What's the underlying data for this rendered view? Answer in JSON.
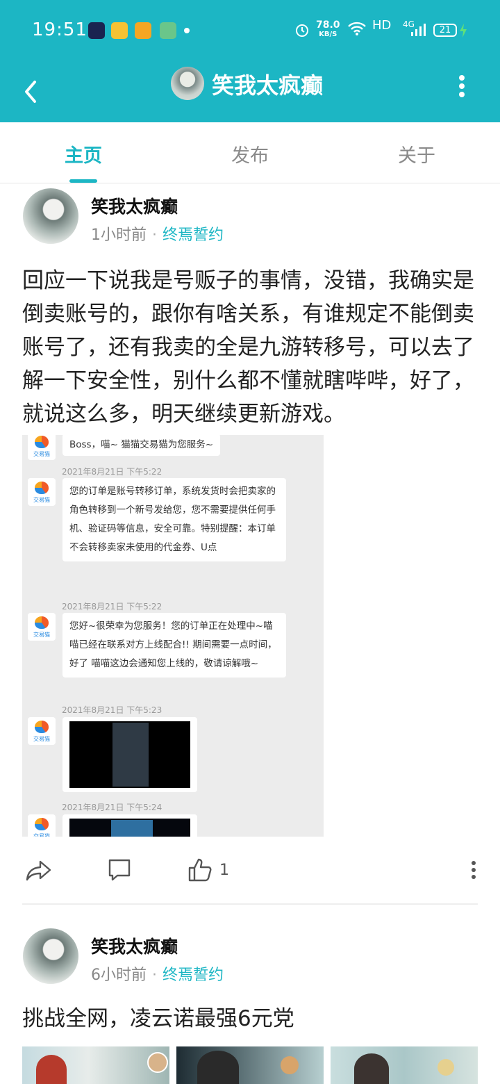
{
  "status": {
    "time": "19:51",
    "speed_value": "78.0",
    "speed_unit": "KB/S",
    "network": "HD",
    "signal": "4G",
    "battery": "21"
  },
  "header": {
    "title": "笑我太疯癫"
  },
  "tabs": [
    {
      "label": "主页"
    },
    {
      "label": "发布"
    },
    {
      "label": "关于"
    }
  ],
  "posts": [
    {
      "author": "笑我太疯癫",
      "time": "1小时前",
      "separator": "·",
      "group": "终焉誓约",
      "text": "回应一下说我是号贩子的事情，没错，我确实是倒卖账号的，跟你有啥关系，有谁规定不能倒卖账号了，还有我卖的全是九游转移号，可以去了解一下安全性，别什么都不懂就瞎哔哔，好了，就说这么多，明天继续更新游戏。",
      "likes": "1",
      "chat": {
        "bot_label": "交易猫",
        "greeting": "Boss，喵~ 猫猫交易猫为您服务~",
        "msg1_time": "2021年8月21日 下午5:22",
        "msg1": "您的订单是账号转移订单，系统发货时会把卖家的角色转移到一个新号发给您，您不需要提供任何手机、验证码等信息，安全可靠。特别提醒：本订单不会转移卖家未使用的代金券、U点",
        "msg2_time": "2021年8月21日 下午5:22",
        "msg2": "您好~很荣幸为您服务！您的订单正在处理中~喵喵已经在联系对方上线配合!! 期间需要一点时间，好了 喵喵这边会通知您上线的，敬请谅解哦~",
        "msg3_time": "2021年8月21日 下午5:23",
        "msg4_time": "2021年8月21日 下午5:24"
      }
    },
    {
      "author": "笑我太疯癫",
      "time": "6小时前",
      "separator": "·",
      "group": "终焉誓约",
      "text": "挑战全网，凌云诺最强6元党"
    }
  ],
  "colors": {
    "accent": "#1cb6c4"
  }
}
